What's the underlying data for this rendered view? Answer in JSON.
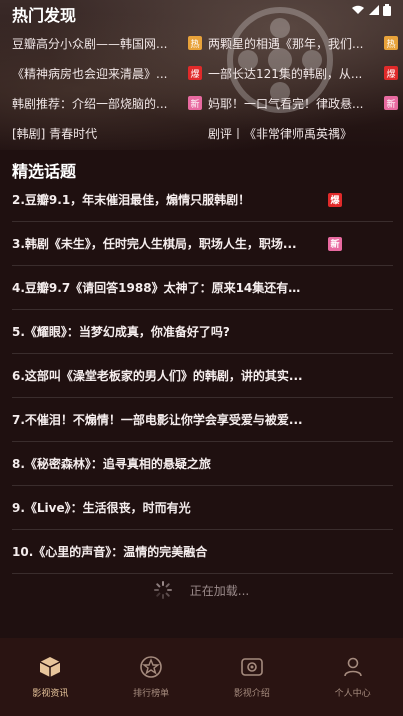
{
  "status": {
    "icons": [
      "wifi-icon",
      "signal-icon",
      "battery-icon"
    ]
  },
  "hot": {
    "title": "热门发现",
    "items": [
      {
        "text": "豆瓣高分小众剧——韩国网...",
        "badge": "热",
        "badge_color": "#e8a23a"
      },
      {
        "text": "两颗星的相遇《那年，我们...",
        "badge": "热",
        "badge_color": "#e8a23a"
      },
      {
        "text": "《精神病房也会迎来清晨》...",
        "badge": "爆",
        "badge_color": "#e02a2a"
      },
      {
        "text": "一部长达121集的韩剧，从...",
        "badge": "爆",
        "badge_color": "#e02a2a"
      },
      {
        "text": "韩剧推荐：介绍一部烧脑的...",
        "badge": "新",
        "badge_color": "#e86aa0"
      },
      {
        "text": "妈耶！一口气看完！律政悬...",
        "badge": "新",
        "badge_color": "#e86aa0"
      },
      {
        "text": "[韩剧] 青春时代",
        "badge": "",
        "badge_color": ""
      },
      {
        "text": "剧评丨《非常律师禹英禑》",
        "badge": "",
        "badge_color": ""
      }
    ]
  },
  "topics": {
    "title": "精选话题",
    "items": [
      {
        "text": "2.豆瓣9.1，年末催泪最佳，煽情只服韩剧！",
        "badge": "爆",
        "badge_color": "#e02a2a"
      },
      {
        "text": "3.韩剧《未生》，任时完人生棋局，职场人生，职场...",
        "badge": "新",
        "badge_color": "#e86aa0"
      },
      {
        "text": "4.豆瓣9.7《请回答1988》太神了：原来14集还有这...",
        "badge": "",
        "badge_color": ""
      },
      {
        "text": "5.《耀眼》：当梦幻成真，你准备好了吗?",
        "badge": "",
        "badge_color": ""
      },
      {
        "text": "6.这部叫《澡堂老板家的男人们》的韩剧，讲的其实...",
        "badge": "",
        "badge_color": ""
      },
      {
        "text": "7.不催泪！不煽情！一部电影让你学会享受爱与被爱...",
        "badge": "",
        "badge_color": ""
      },
      {
        "text": "8.《秘密森林》：追寻真相的悬疑之旅",
        "badge": "",
        "badge_color": ""
      },
      {
        "text": "9.《Live》：生活很丧，时而有光",
        "badge": "",
        "badge_color": ""
      },
      {
        "text": "10.《心里的声音》：温情的完美融合",
        "badge": "",
        "badge_color": ""
      }
    ]
  },
  "loading": {
    "text": "正在加载..."
  },
  "tabs": [
    {
      "label": "影视资讯",
      "icon": "package-icon",
      "active": true
    },
    {
      "label": "排行榜单",
      "icon": "ranking-icon",
      "active": false
    },
    {
      "label": "影视介绍",
      "icon": "film-icon",
      "active": false
    },
    {
      "label": "个人中心",
      "icon": "user-icon",
      "active": false
    }
  ]
}
